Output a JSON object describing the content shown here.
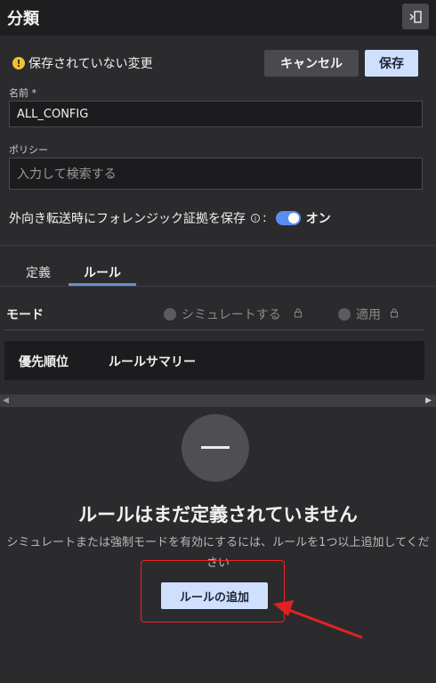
{
  "header": {
    "title": "分類",
    "panel_toggle_icon": "panel-toggle-icon"
  },
  "toolbar": {
    "unsaved_text": "保存されていない変更",
    "cancel_label": "キャンセル",
    "save_label": "保存"
  },
  "form": {
    "name_label": "名前",
    "name_required": "*",
    "name_value": "ALL_CONFIG",
    "policy_label": "ポリシー",
    "policy_placeholder": "入力して検索する",
    "forensic_label": "外向き転送時にフォレンジック証拠を保存",
    "forensic_info_icon": "i",
    "forensic_colon": ":",
    "forensic_toggle_label": "オン",
    "forensic_enabled": true
  },
  "tabs": [
    {
      "label": "定義",
      "active": false
    },
    {
      "label": "ルール",
      "active": true
    }
  ],
  "mode": {
    "label": "モード",
    "options": [
      {
        "label": "シミュレートする",
        "locked": true
      },
      {
        "label": "適用",
        "locked": true
      }
    ]
  },
  "table": {
    "columns": [
      "優先順位",
      "ルールサマリー"
    ]
  },
  "empty_state": {
    "title": "ルールはまだ定義されていません",
    "description": "シミュレートまたは強制モードを有効にするには、ルールを1つ以上追加してください",
    "add_button": "ルールの追加"
  },
  "colors": {
    "accent": "#cfe0ff",
    "toggle": "#5b8def",
    "warning": "#f2c230",
    "annotation": "#e22222"
  }
}
